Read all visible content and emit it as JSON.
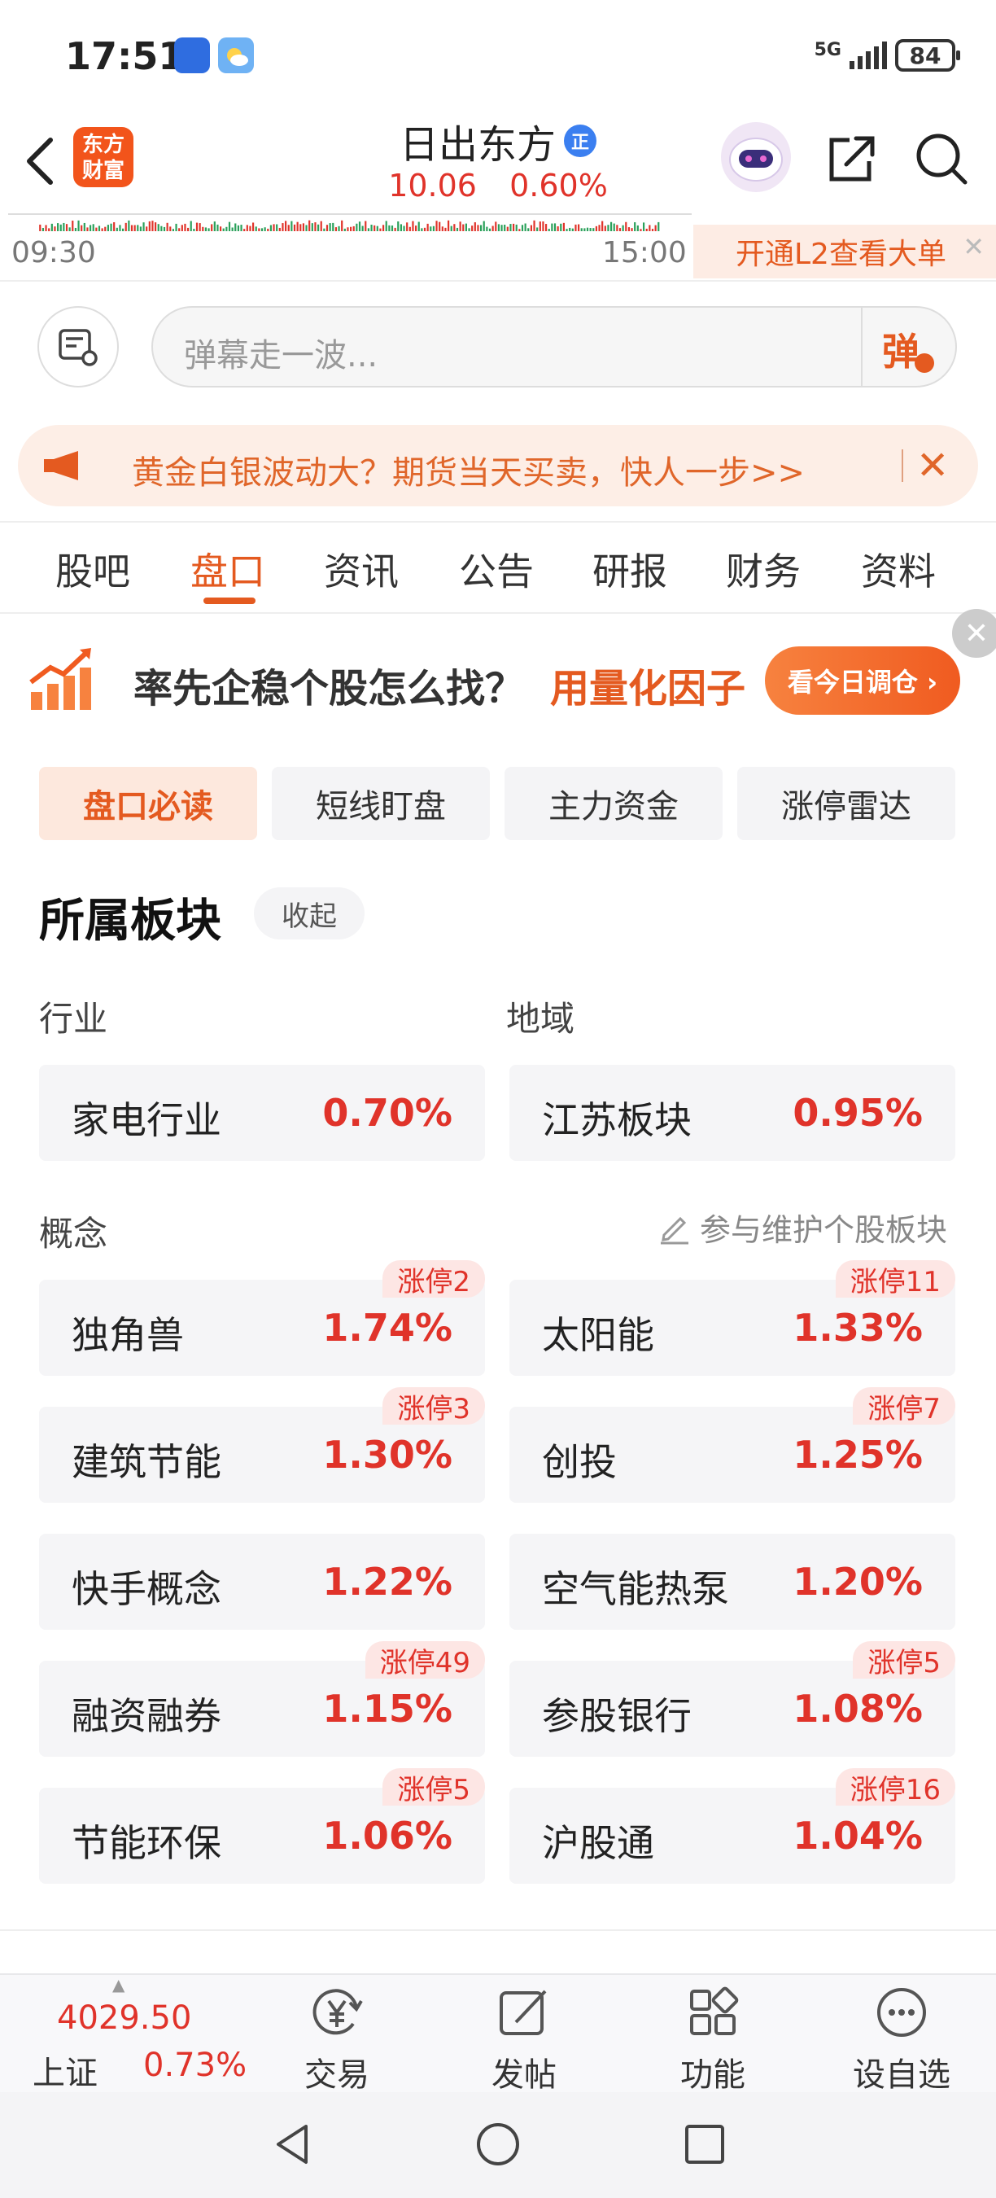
{
  "status_bar": {
    "time": "17:51",
    "network": "5G",
    "battery": "84"
  },
  "header": {
    "logo_text": "东方财富",
    "stock_name": "日出东方",
    "badge": "正",
    "price": "10.06",
    "change_pct": "0.60%"
  },
  "mini_chart": {
    "start_time": "09:30",
    "end_time": "15:00",
    "l2_banner": "开通L2查看大单"
  },
  "danmu": {
    "placeholder": "弹幕走一波...",
    "button": "弹"
  },
  "ad_banner": {
    "text": "黄金白银波动大？期货当天买卖，快人一步>>",
    "close": "✕"
  },
  "tabs": [
    "股吧",
    "盘口",
    "资讯",
    "公告",
    "研报",
    "财务",
    "资料"
  ],
  "active_tab": "盘口",
  "promo": {
    "text": "率先企稳个股怎么找？",
    "highlight": "用量化因子",
    "button": "看今日调仓 ›"
  },
  "sub_tabs": [
    "盘口必读",
    "短线盯盘",
    "主力资金",
    "涨停雷达"
  ],
  "sectors": {
    "title": "所属板块",
    "collapse": "收起",
    "industry_label": "行业",
    "region_label": "地域",
    "industry": {
      "name": "家电行业",
      "pct": "0.70%"
    },
    "region": {
      "name": "江苏板块",
      "pct": "0.95%"
    },
    "concept_label": "概念",
    "maintain": "参与维护个股板块",
    "concepts": [
      {
        "name": "独角兽",
        "pct": "1.74%",
        "badge": "涨停2"
      },
      {
        "name": "太阳能",
        "pct": "1.33%",
        "badge": "涨停11"
      },
      {
        "name": "建筑节能",
        "pct": "1.30%",
        "badge": "涨停3"
      },
      {
        "name": "创投",
        "pct": "1.25%",
        "badge": "涨停7"
      },
      {
        "name": "快手概念",
        "pct": "1.22%",
        "badge": ""
      },
      {
        "name": "空气能热泵",
        "pct": "1.20%",
        "badge": ""
      },
      {
        "name": "融资融券",
        "pct": "1.15%",
        "badge": "涨停49"
      },
      {
        "name": "参股银行",
        "pct": "1.08%",
        "badge": "涨停5"
      },
      {
        "name": "节能环保",
        "pct": "1.06%",
        "badge": "涨停5"
      },
      {
        "name": "沪股通",
        "pct": "1.04%",
        "badge": "涨停16"
      }
    ]
  },
  "bottom_bar": {
    "index_value": "4029.50",
    "index_name": "上证",
    "index_pct": "0.73%",
    "nav": [
      {
        "label": "交易",
        "icon": "yen-trade-icon"
      },
      {
        "label": "发帖",
        "icon": "edit-post-icon"
      },
      {
        "label": "功能",
        "icon": "grid-function-icon"
      },
      {
        "label": "设自选",
        "icon": "more-dots-icon"
      }
    ]
  },
  "colors": {
    "accent": "#e45a20",
    "up_red": "#e0332a"
  }
}
